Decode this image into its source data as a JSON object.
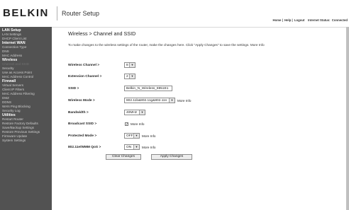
{
  "header": {
    "logo": "BELKIN",
    "title": "Router Setup",
    "links": {
      "home": "Home",
      "help": "Help",
      "logout": "Logout",
      "status_label": "Internet Status:",
      "status_value": "Connected"
    }
  },
  "sidebar": {
    "items": [
      {
        "label": "LAN Setup",
        "type": "section"
      },
      {
        "label": "LAN Settings",
        "type": "link"
      },
      {
        "label": "DHCP Client List",
        "type": "link"
      },
      {
        "label": "Internet WAN",
        "type": "section"
      },
      {
        "label": "Connection Type",
        "type": "link"
      },
      {
        "label": "DNS",
        "type": "link"
      },
      {
        "label": "MAC Address",
        "type": "link"
      },
      {
        "label": "Wireless",
        "type": "section"
      },
      {
        "label": "Channel and SSID",
        "type": "active"
      },
      {
        "label": "Security",
        "type": "link"
      },
      {
        "label": "Use as Access Point",
        "type": "link"
      },
      {
        "label": "MAC Address Control",
        "type": "link"
      },
      {
        "label": "Firewall",
        "type": "section"
      },
      {
        "label": "Virtual Servers",
        "type": "link"
      },
      {
        "label": "Client IP Filters",
        "type": "link"
      },
      {
        "label": "MAC Address Filtering",
        "type": "link"
      },
      {
        "label": "DMZ",
        "type": "link"
      },
      {
        "label": "DDNS",
        "type": "link"
      },
      {
        "label": "WAN Ping Blocking",
        "type": "link"
      },
      {
        "label": "Security Log",
        "type": "link"
      },
      {
        "label": "Utilities",
        "type": "section"
      },
      {
        "label": "Restart Router",
        "type": "link"
      },
      {
        "label": "Restore Factory Defaults",
        "type": "link"
      },
      {
        "label": "Save/Backup Settings",
        "type": "link"
      },
      {
        "label": "Restore Previous Settings",
        "type": "link"
      },
      {
        "label": "Firmware Update",
        "type": "link"
      },
      {
        "label": "System Settings",
        "type": "link"
      }
    ]
  },
  "main": {
    "title": "Wireless > Channel and SSID",
    "intro": "To make changes to the wireless settings of the router, make the changes here. Click \"Apply Changes\" to save the settings. More Info",
    "fields": {
      "wireless_channel": {
        "label": "Wireless Channel >",
        "value": "8"
      },
      "extension_channel": {
        "label": "Extension Channel >",
        "value": "2"
      },
      "ssid": {
        "label": "SSID >",
        "value": "Belkin_N_Wireless_8851E1"
      },
      "wireless_mode": {
        "label": "Wireless Mode >",
        "value": "802.11b&802.11g&802.11n",
        "more": "More Info"
      },
      "bandwidth": {
        "label": "Bandwidth >",
        "value": "40MHz"
      },
      "broadcast_ssid": {
        "label": "Broadcast SSID >",
        "checked": true,
        "more": "More Info"
      },
      "protected_mode": {
        "label": "Protected Mode >",
        "value": "OFF",
        "more": "More Info"
      },
      "wmm_qos": {
        "label": "802.11e/WMM QoS >",
        "value": "ON",
        "more": "More Info"
      }
    },
    "buttons": {
      "clear": "Clear Changes",
      "apply": "Apply Changes"
    }
  },
  "colors": {
    "sidebar_bg": "#525252",
    "section_text": "#ffffff",
    "link_text": "#cfcfcf"
  }
}
